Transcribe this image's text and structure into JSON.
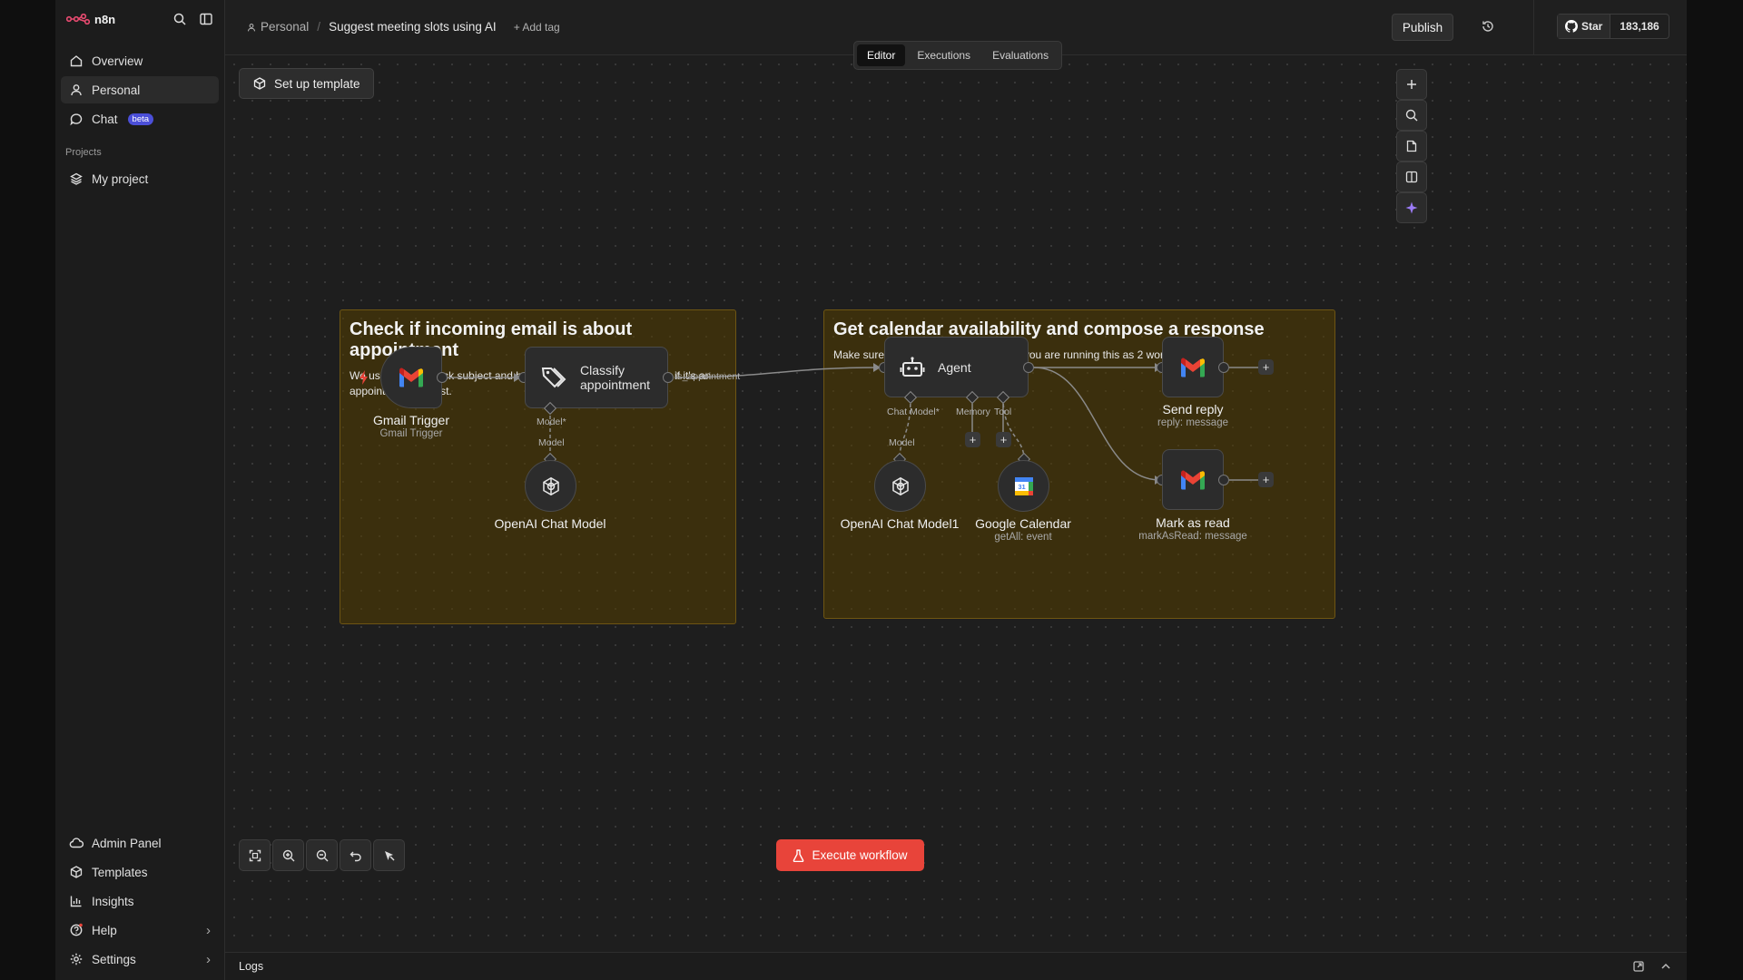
{
  "app": {
    "logo": "n8n"
  },
  "sidebar": {
    "items": [
      {
        "label": "Overview"
      },
      {
        "label": "Personal"
      },
      {
        "label": "Chat",
        "badge": "beta"
      }
    ],
    "projects_heading": "Projects",
    "projects": [
      {
        "label": "My project"
      }
    ],
    "bottom": [
      {
        "label": "Admin Panel"
      },
      {
        "label": "Templates"
      },
      {
        "label": "Insights"
      },
      {
        "label": "Help"
      },
      {
        "label": "Settings"
      }
    ]
  },
  "topbar": {
    "breadcrumb_project": "Personal",
    "workflow_name": "Suggest meeting slots using AI",
    "add_tag": "+ Add tag",
    "publish": "Publish",
    "github_star": "Star",
    "github_count": "183,186"
  },
  "tabs": [
    "Editor",
    "Executions",
    "Evaluations"
  ],
  "canvas": {
    "setup_template": "Set up template",
    "sticky1": {
      "title": "Check if incoming email is about appointment",
      "body": "We use LLM to check subject and body of the email and determine if it's an appointment request."
    },
    "sticky2": {
      "title": "Get calendar availability and compose a response",
      "body": "Make sure to update the Workflow ID if you are running this as 2 workflows"
    },
    "nodes": {
      "gmail_trigger": {
        "name": "Gmail Trigger",
        "sub": "Gmail Trigger"
      },
      "classify": {
        "name": "Classify appointment",
        "line1": "Classify",
        "line2": "appointment",
        "port_model": "Model*",
        "output": "is_appointment"
      },
      "openai1": {
        "name": "OpenAI Chat Model",
        "port": "Model"
      },
      "agent": {
        "name": "Agent",
        "chat_model": "Chat Model*",
        "memory": "Memory",
        "tool": "Tool"
      },
      "openai2": {
        "name": "OpenAI Chat Model1",
        "port": "Model"
      },
      "gcal": {
        "name": "Google Calendar",
        "sub": "getAll: event"
      },
      "send_reply": {
        "name": "Send reply",
        "sub": "reply: message"
      },
      "mark_read": {
        "name": "Mark as read",
        "sub": "markAsRead: message"
      }
    },
    "execute": "Execute workflow"
  },
  "logs": {
    "label": "Logs"
  },
  "colors": {
    "accent": "#e8443a",
    "sticky": "#543e00",
    "beta": "#4b4fd8"
  }
}
